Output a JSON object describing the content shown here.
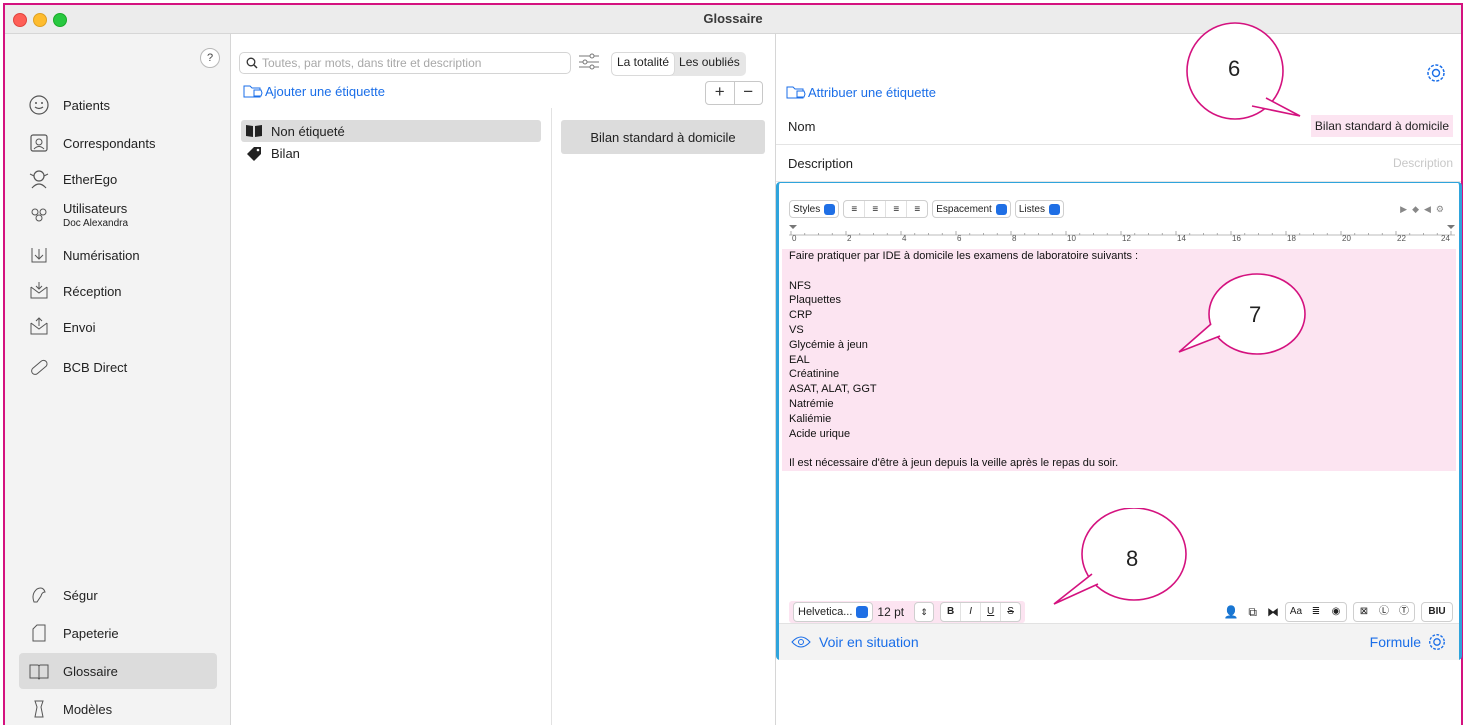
{
  "window": {
    "title": "Glossaire"
  },
  "sidebar": {
    "help_label": "?",
    "items": [
      {
        "label": "Patients",
        "icon": "smiley-icon"
      },
      {
        "label": "Correspondants",
        "icon": "contact-card-icon"
      },
      {
        "label": "EtherEgo",
        "icon": "ether-ego-icon"
      },
      {
        "label": "Utilisateurs",
        "sublabel": "Doc Alexandra",
        "icon": "users-icon"
      },
      {
        "label": "Numérisation",
        "icon": "scan-icon"
      },
      {
        "label": "Réception",
        "icon": "inbox-receive-icon"
      },
      {
        "label": "Envoi",
        "icon": "inbox-send-icon"
      },
      {
        "label": "BCB Direct",
        "icon": "pill-icon"
      }
    ],
    "bottom_items": [
      {
        "label": "Ségur",
        "icon": "segur-icon"
      },
      {
        "label": "Papeterie",
        "icon": "document-icon"
      },
      {
        "label": "Glossaire",
        "icon": "book-icon",
        "active": true
      },
      {
        "label": "Modèles",
        "icon": "template-icon"
      }
    ]
  },
  "list_panel": {
    "search_placeholder": "Toutes, par mots, dans titre et description",
    "segments": [
      "La totalité",
      "Les oubliés"
    ],
    "add_tag_label": "Ajouter une étiquette",
    "plus": "+",
    "minus": "−",
    "tags": [
      {
        "label": "Non étiqueté",
        "icon": "open-book-icon",
        "selected": true
      },
      {
        "label": "Bilan",
        "icon": "tag-icon"
      }
    ],
    "entries": [
      "Bilan standard à domicile"
    ]
  },
  "detail": {
    "assign_tag_label": "Attribuer une étiquette",
    "name_label": "Nom",
    "name_value": "Bilan standard à domicile",
    "description_label": "Description",
    "description_placeholder": "Description",
    "toolbar": {
      "styles": "Styles",
      "spacing": "Espacement",
      "lists": "Listes"
    },
    "ruler_ticks": [
      "0",
      "2",
      "4",
      "6",
      "8",
      "10",
      "12",
      "14",
      "16",
      "18",
      "20",
      "22",
      "24"
    ],
    "body_lines": [
      "Faire pratiquer par IDE à domicile les examens de laboratoire suivants :",
      "",
      "NFS",
      "Plaquettes",
      "CRP",
      "VS",
      "Glycémie à jeun",
      "EAL",
      "Créatinine",
      "ASAT, ALAT, GGT",
      "Natrémie",
      "Kaliémie",
      "Acide urique",
      "",
      "Il est nécessaire d'être à jeun depuis la veille après le repas du soir."
    ],
    "font_bar": {
      "font": "Helvetica...",
      "size": "12 pt",
      "bold": "B",
      "italic": "I",
      "underline": "U",
      "strike": "S",
      "aa": "Aa",
      "biu": "BIU"
    },
    "voir_label": "Voir en situation",
    "formule_label": "Formule"
  },
  "callouts": {
    "c6": "6",
    "c7": "7",
    "c8": "8"
  },
  "colors": {
    "accent": "#1a6ee8",
    "highlight": "#fce4f1",
    "frame": "#d4127f",
    "editor_border": "#2fa4dc"
  }
}
